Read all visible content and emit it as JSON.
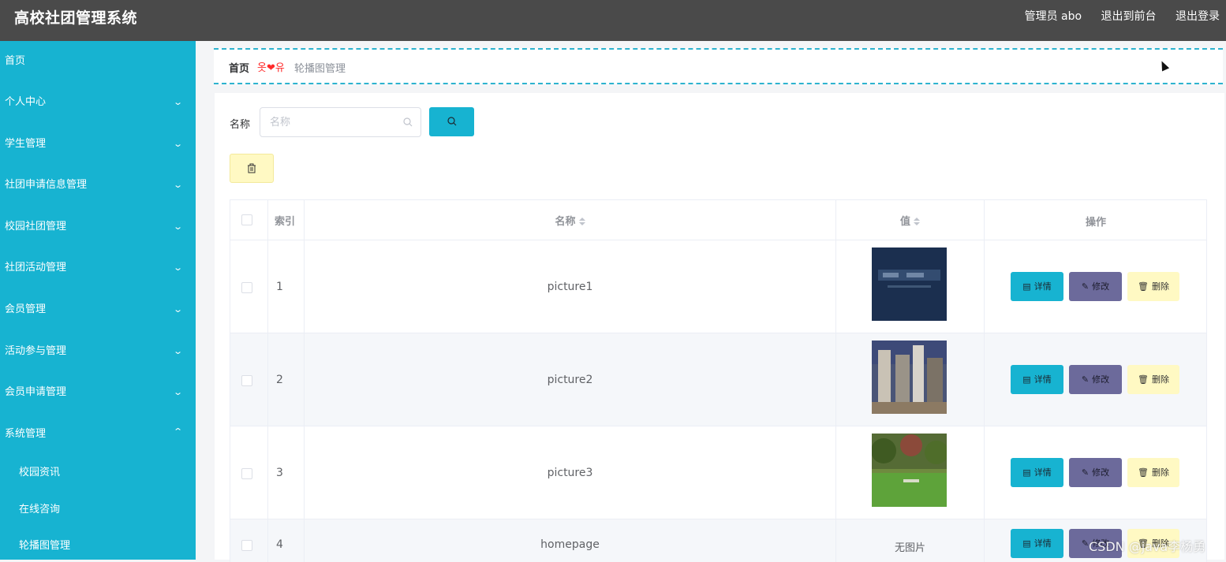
{
  "header": {
    "title": "高校社团管理系统",
    "user": "管理员 abo",
    "to_front": "退出到前台",
    "logout": "退出登录"
  },
  "sidebar": {
    "items": [
      {
        "label": "首页"
      },
      {
        "label": "个人中心"
      },
      {
        "label": "学生管理"
      },
      {
        "label": "社团申请信息管理"
      },
      {
        "label": "校园社团管理"
      },
      {
        "label": "社团活动管理"
      },
      {
        "label": "会员管理"
      },
      {
        "label": "活动参与管理"
      },
      {
        "label": "会员申请管理"
      },
      {
        "label": "系统管理"
      }
    ],
    "subitems": [
      {
        "label": "校园资讯"
      },
      {
        "label": "在线咨询"
      },
      {
        "label": "轮播图管理"
      }
    ]
  },
  "breadcrumb": {
    "home": "首页",
    "separator": "옷❤유",
    "current": "轮播图管理"
  },
  "search": {
    "label": "名称",
    "placeholder": "名称",
    "value": ""
  },
  "table": {
    "headers": {
      "index": "索引",
      "name": "名称",
      "value": "值",
      "actions": "操作"
    },
    "rows": [
      {
        "index": "1",
        "name": "picture1",
        "value": "",
        "has_image": true
      },
      {
        "index": "2",
        "name": "picture2",
        "value": "",
        "has_image": true
      },
      {
        "index": "3",
        "name": "picture3",
        "value": "",
        "has_image": true
      },
      {
        "index": "4",
        "name": "homepage",
        "value": "无图片",
        "has_image": false
      }
    ],
    "actions": {
      "detail": "详情",
      "edit": "修改",
      "delete": "删除"
    }
  },
  "watermark": "CSDN @java李杨勇",
  "colors": {
    "topbar": "#4a4a4a",
    "sidebar": "#17b3d1",
    "primary": "#17b3d1",
    "edit": "#6c6a9b",
    "danger_bg": "#fff9c3"
  }
}
